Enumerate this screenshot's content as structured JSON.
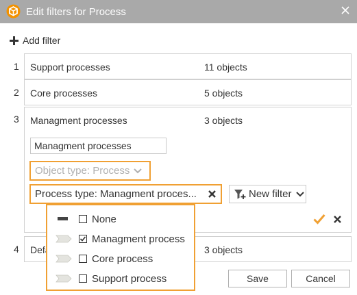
{
  "window": {
    "title": "Edit filters for Process"
  },
  "toolbar": {
    "add_filter_label": "Add filter"
  },
  "filters": [
    {
      "num": "1",
      "name": "Support processes",
      "count": "11 objects"
    },
    {
      "num": "2",
      "name": "Core processes",
      "count": "5 objects"
    },
    {
      "num": "3",
      "name": "Managment processes",
      "count": "3 objects",
      "name_input_value": "Managment processes",
      "object_type_label": "Object type: Process",
      "process_type_label": "Process type: Managment proces...",
      "new_filter_label": "New filter"
    },
    {
      "num": "4",
      "name": "Defa",
      "count": "3 objects"
    }
  ],
  "dropdown": {
    "items": [
      {
        "label": "None",
        "checked": false,
        "symbol": "none-bar-icon"
      },
      {
        "label": "Managment process",
        "checked": true,
        "symbol": "chevron-shape-icon"
      },
      {
        "label": "Core process",
        "checked": false,
        "symbol": "chevron-shape-icon"
      },
      {
        "label": "Support process",
        "checked": false,
        "symbol": "chevron-shape-icon"
      }
    ]
  },
  "footer": {
    "save_label": "Save",
    "cancel_label": "Cancel"
  },
  "colors": {
    "titlebar": "#a9a9a9",
    "accent": "#f0a033",
    "logo": "#f39200"
  }
}
